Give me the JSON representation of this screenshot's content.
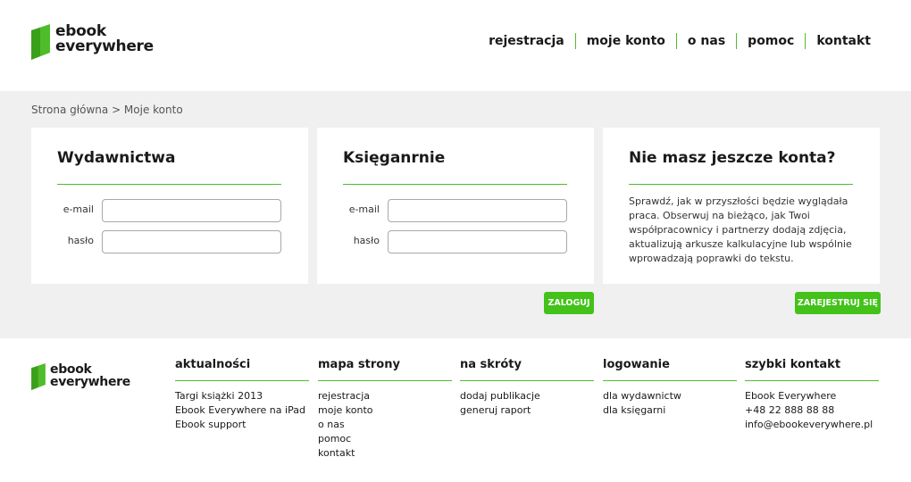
{
  "brand": {
    "line1": "ebook",
    "line2": "everywhere",
    "color": "#4fbd2a"
  },
  "nav": [
    "rejestracja",
    "moje konto",
    "o nas",
    "pomoc",
    "kontakt"
  ],
  "breadcrumb": "Strona główna > Moje konto",
  "panels": {
    "publishers": {
      "title": "Wydawnictwa",
      "email_label": "e-mail",
      "password_label": "hasło",
      "email_value": "",
      "password_value": ""
    },
    "bookstores": {
      "title": "Księganrnie",
      "email_label": "e-mail",
      "password_label": "hasło",
      "email_value": "",
      "password_value": ""
    },
    "register": {
      "title": "Nie masz jeszcze konta?",
      "text": "Sprawdź, jak w przyszłości będzie wyglądała praca. Obserwuj na bieżąco, jak Twoi współpracownicy i partnerzy dodają zdjęcia, aktualizują arkusze kalkulacyjne lub wspólnie wprowadzają poprawki do tekstu."
    }
  },
  "buttons": {
    "login": "ZALOGUJ",
    "register": "ZAREJESTRUJ SIĘ"
  },
  "footer": {
    "columns": [
      {
        "title": "aktualności",
        "items": [
          "Targi książki 2013",
          "Ebook Everywhere na iPad",
          "Ebook support"
        ]
      },
      {
        "title": "mapa strony",
        "items": [
          "rejestracja",
          "moje konto",
          "o nas",
          "pomoc",
          "kontakt"
        ]
      },
      {
        "title": "na skróty",
        "items": [
          "dodaj publikacje",
          "generuj raport"
        ]
      },
      {
        "title": "logowanie",
        "items": [
          "dla wydawnictw",
          "dla księgarni"
        ]
      },
      {
        "title": "szybki kontakt",
        "items": [
          "Ebook Everywhere",
          "+48 22 888 88 88",
          "info@ebookeverywhere.pl"
        ]
      }
    ]
  },
  "colors": {
    "accent": "#4fbd2a",
    "button": "#43c21a",
    "background": "#f0f0f0"
  }
}
